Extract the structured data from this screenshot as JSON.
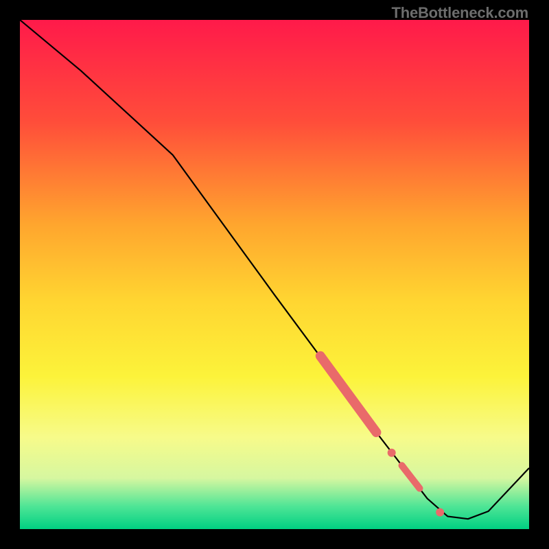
{
  "watermark": "TheBottleneck.com",
  "chart_data": {
    "type": "line",
    "title": "",
    "xlabel": "",
    "ylabel": "",
    "xlim": [
      0,
      100
    ],
    "ylim": [
      0,
      100
    ],
    "gradient_stops": [
      {
        "offset": 0,
        "color": "#ff1a4a"
      },
      {
        "offset": 0.2,
        "color": "#ff4d3a"
      },
      {
        "offset": 0.4,
        "color": "#ffa52e"
      },
      {
        "offset": 0.55,
        "color": "#ffd531"
      },
      {
        "offset": 0.7,
        "color": "#fcf33a"
      },
      {
        "offset": 0.82,
        "color": "#f7fb8a"
      },
      {
        "offset": 0.9,
        "color": "#d6f7a0"
      },
      {
        "offset": 0.955,
        "color": "#4fe596"
      },
      {
        "offset": 1.0,
        "color": "#00d082"
      }
    ],
    "series": [
      {
        "name": "curve",
        "points": [
          {
            "x": 0.0,
            "y": 100.0
          },
          {
            "x": 12.0,
            "y": 90.0
          },
          {
            "x": 24.0,
            "y": 79.0
          },
          {
            "x": 30.0,
            "y": 73.5
          },
          {
            "x": 50.0,
            "y": 46.0
          },
          {
            "x": 60.0,
            "y": 32.5
          },
          {
            "x": 70.0,
            "y": 19.0
          },
          {
            "x": 80.0,
            "y": 6.0
          },
          {
            "x": 84.0,
            "y": 2.5
          },
          {
            "x": 88.0,
            "y": 2.0
          },
          {
            "x": 92.0,
            "y": 3.5
          },
          {
            "x": 100.0,
            "y": 12.0
          }
        ]
      }
    ],
    "highlight": {
      "color": "#e96a6a",
      "segments": [
        {
          "kind": "bar",
          "x1": 59.0,
          "y1": 34.0,
          "x2": 70.0,
          "y2": 19.0,
          "width": 14
        },
        {
          "kind": "dot",
          "x": 73.0,
          "y": 15.0,
          "r": 6
        },
        {
          "kind": "bar",
          "x1": 75.0,
          "y1": 12.5,
          "x2": 78.5,
          "y2": 8.0,
          "width": 10
        },
        {
          "kind": "dot",
          "x": 82.5,
          "y": 3.3,
          "r": 6
        }
      ]
    }
  }
}
